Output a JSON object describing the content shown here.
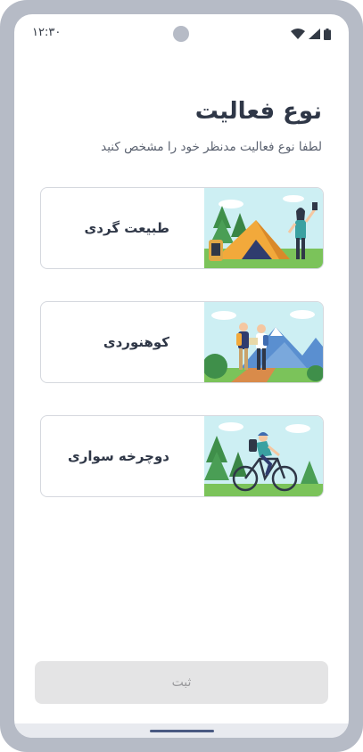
{
  "status_bar": {
    "time": "۱۲:۳۰",
    "icons": [
      "wifi-icon",
      "signal-icon",
      "battery-icon"
    ]
  },
  "header": {
    "title": "نوع فعالیت",
    "subtitle": "لطفا نوع فعالیت مدنظر خود را مشخص کنید"
  },
  "activities": [
    {
      "label": "طبیعت گردی",
      "image": "camping-illustration"
    },
    {
      "label": "کوهنوردی",
      "image": "hiking-illustration"
    },
    {
      "label": "دوچرخه سواری",
      "image": "cycling-illustration"
    }
  ],
  "footer": {
    "submit_label": "ثبت"
  },
  "colors": {
    "frame": "#b6bbc6",
    "text_primary": "#2f3747",
    "text_secondary": "#5b6270",
    "card_border": "#d5d8de",
    "button_disabled_bg": "#e4e4e5",
    "button_disabled_text": "#9a9a9d",
    "sky": "#cdeff3",
    "grass": "#7bc35a"
  }
}
